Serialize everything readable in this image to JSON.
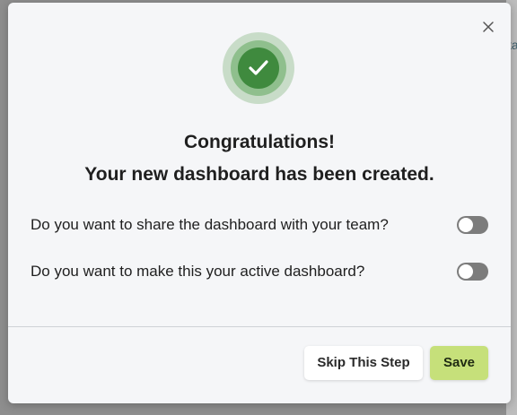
{
  "background": {
    "partial_text": "ta"
  },
  "dialog": {
    "close_icon": "close-icon",
    "success_icon": "checkmark-icon",
    "title": "Congratulations!",
    "subtitle": "Your new dashboard has been created.",
    "questions": [
      {
        "label": "Do you want to share the dashboard with your team?",
        "enabled": false
      },
      {
        "label": "Do you want to make this your active dashboard?",
        "enabled": false
      }
    ],
    "buttons": {
      "skip_label": "Skip This Step",
      "save_label": "Save"
    }
  },
  "colors": {
    "success_green": "#3f8a3e",
    "save_button": "#c6e07a",
    "toggle_off": "#7c7c7c"
  }
}
